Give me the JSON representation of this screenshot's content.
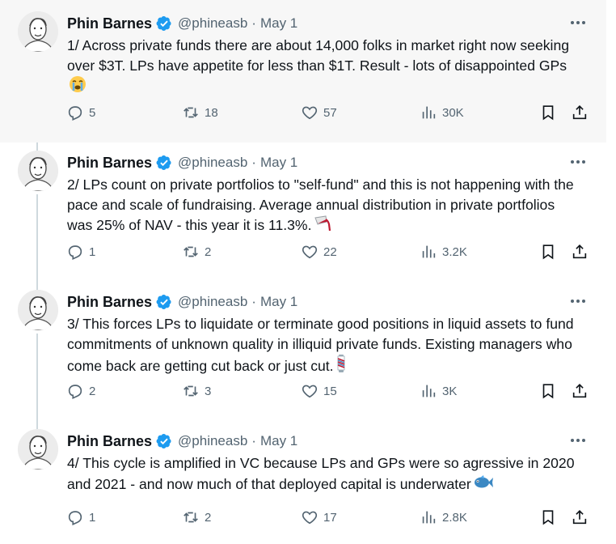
{
  "tweets": [
    {
      "name": "Phin Barnes",
      "handle": "@phineasb",
      "separator": "·",
      "date": "May 1",
      "text": "1/ Across private funds there are about 14,000 folks in market right now seeking over $3T. LPs have appetite for less than $1T. Result - lots of disappointed GPs",
      "emoji": "crying-face",
      "replies": "5",
      "retweets": "18",
      "likes": "57",
      "views": "30K",
      "highlighted": true
    },
    {
      "name": "Phin Barnes",
      "handle": "@phineasb",
      "separator": "·",
      "date": "May 1",
      "text": "2/ LPs count on private portfolios to \"self-fund\" and this is not happening with the pace and scale of fundraising. Average annual distribution in private portfolios was 25% of NAV - this year it is 11.3%.",
      "emoji": "spilled-glass",
      "replies": "1",
      "retweets": "2",
      "likes": "22",
      "views": "3.2K",
      "highlighted": false
    },
    {
      "name": "Phin Barnes",
      "handle": "@phineasb",
      "separator": "·",
      "date": "May 1",
      "text": "3/ This forces LPs to liquidate or terminate good positions in liquid assets to fund commitments of unknown quality in illiquid private funds. Existing managers who come back are getting cut back or just cut.",
      "emoji": "barber-pole",
      "replies": "2",
      "retweets": "3",
      "likes": "15",
      "views": "3K",
      "highlighted": false
    },
    {
      "name": "Phin Barnes",
      "handle": "@phineasb",
      "separator": "·",
      "date": "May 1",
      "text": "4/ This cycle is amplified in VC because LPs and GPs were so agressive in 2020 and 2021 - and now much of that deployed capital is underwater",
      "emoji": "fish",
      "replies": "1",
      "retweets": "2",
      "likes": "17",
      "views": "2.8K",
      "highlighted": false
    }
  ],
  "colors": {
    "text": "#0f1419",
    "muted": "#536471",
    "verified": "#1d9bf0",
    "thread_line": "#cfd9de",
    "highlight_bg": "#f7f7f7"
  },
  "icons": [
    "verified-badge-icon",
    "more-icon",
    "reply-icon",
    "retweet-icon",
    "like-icon",
    "views-icon",
    "bookmark-icon",
    "share-icon"
  ]
}
